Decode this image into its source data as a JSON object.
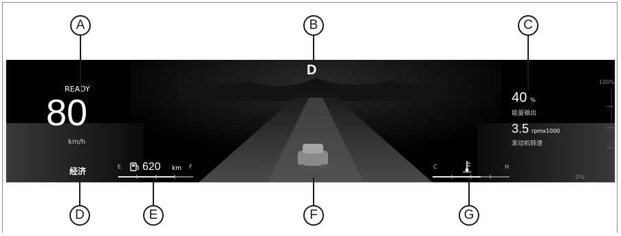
{
  "callouts": [
    "A",
    "B",
    "C",
    "D",
    "E",
    "F",
    "G"
  ],
  "cluster": {
    "gear": "D",
    "ready": "READY",
    "speed": "80",
    "speed_unit": "km/h",
    "drive_mode": "经济",
    "fuel": {
      "empty_label": "E",
      "full_label": "F",
      "range_value": "620",
      "range_unit": "km",
      "icon": "fuel-pump-icon"
    },
    "power": {
      "value": "40",
      "unit": "%",
      "label": "能量输出",
      "scale_max": "100%",
      "scale_min": "0%"
    },
    "rpm": {
      "value": "3.5",
      "unit": "rpmx1000",
      "label": "发动机转速"
    },
    "temperature": {
      "cold_label": "C",
      "hot_label": "H",
      "icon": "coolant-thermometer-icon"
    },
    "center_icon": "vehicle-icon",
    "colors": {
      "background": "#000000",
      "text": "#ffffff",
      "road": "#3a3a3a"
    }
  }
}
